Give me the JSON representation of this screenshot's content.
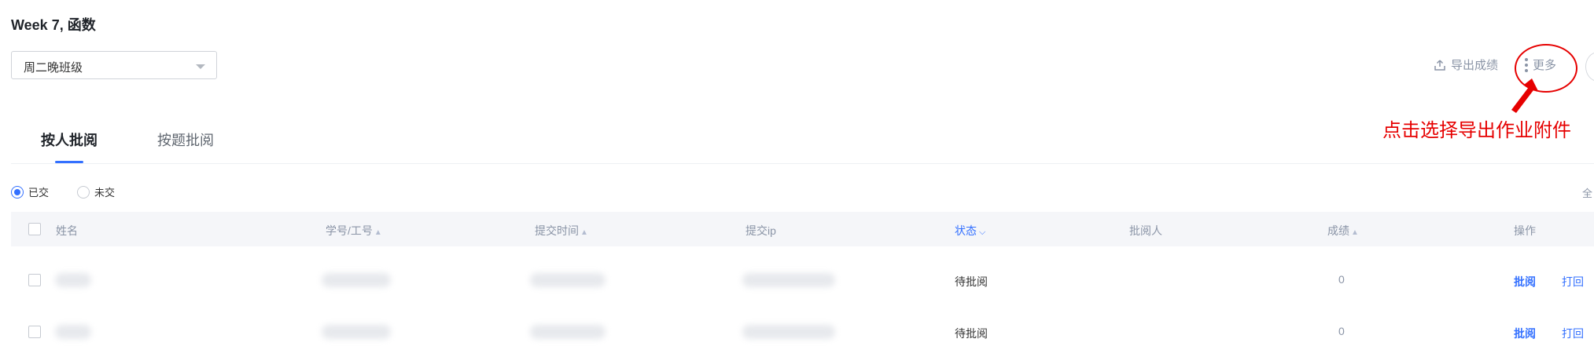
{
  "page": {
    "title": "Week 7, 函数"
  },
  "class_select": {
    "value": "周二晚班级"
  },
  "toolbar": {
    "export_label": "导出成绩",
    "more_label": "更多"
  },
  "annotation": {
    "text": "点击选择导出作业附件",
    "color": "#e60000"
  },
  "tabs": [
    {
      "label": "按人批阅",
      "active": true
    },
    {
      "label": "按题批阅",
      "active": false
    }
  ],
  "filter": {
    "options": [
      {
        "label": "已交",
        "checked": true
      },
      {
        "label": "未交",
        "checked": false
      }
    ],
    "right_text": "全"
  },
  "table": {
    "columns": {
      "name": "姓名",
      "student_id": "学号/工号",
      "submit_time": "提交时间",
      "submit_ip": "提交ip",
      "status": "状态",
      "grader": "批阅人",
      "score": "成绩",
      "actions": "操作"
    },
    "rows": [
      {
        "name_visible": "",
        "status": "待批阅",
        "score": "0",
        "action_review": "批阅",
        "action_return": "打回"
      },
      {
        "name_visible": "",
        "status": "待批阅",
        "score": "0",
        "action_review": "批阅",
        "action_return": "打回"
      }
    ]
  },
  "colors": {
    "accent": "#3370ff",
    "muted": "#8a94a6",
    "annotation": "#e60000"
  }
}
